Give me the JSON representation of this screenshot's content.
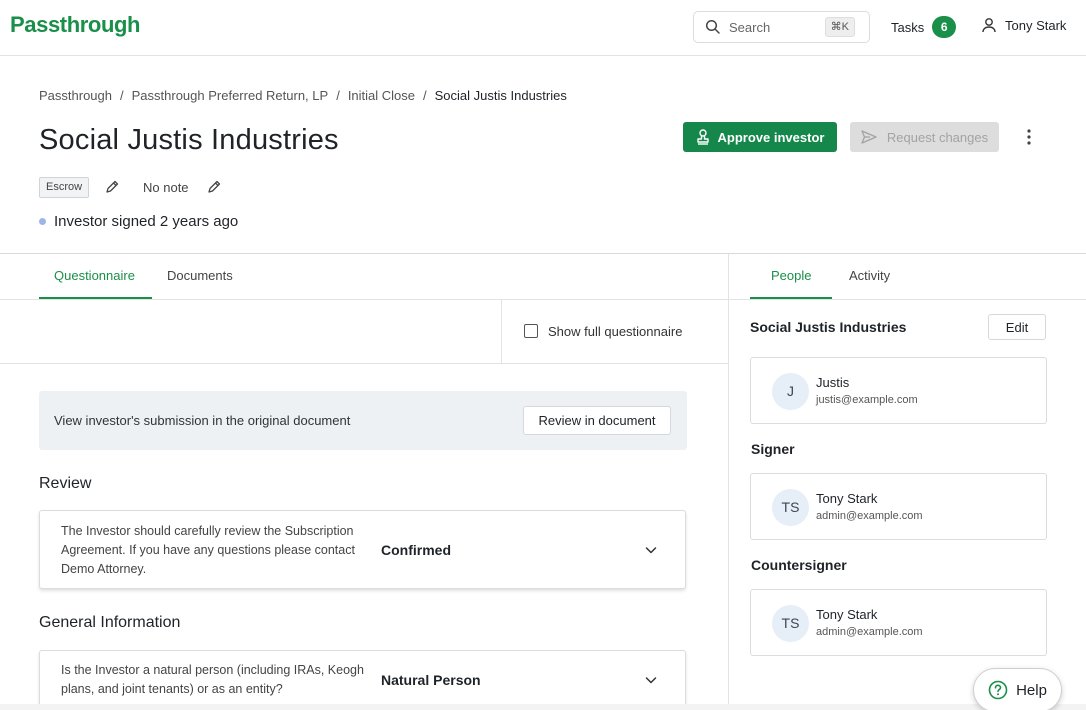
{
  "brand": {
    "logo_text": "Passthrough",
    "accent": "#1a8f4a"
  },
  "topbar": {
    "search_label": "Search",
    "search_shortcut": "⌘K",
    "tasks_label": "Tasks",
    "tasks_count": "6",
    "user_name": "Tony Stark"
  },
  "breadcrumb": [
    {
      "label": "Passthrough"
    },
    {
      "label": "Passthrough Preferred Return, LP"
    },
    {
      "label": "Initial Close"
    },
    {
      "label": "Social Justis Industries"
    }
  ],
  "header": {
    "title": "Social Justis Industries",
    "approve_label": "Approve investor",
    "request_label": "Request changes",
    "chip_label": "Escrow",
    "note_text": "No note",
    "status_text": "Investor signed 2 years ago"
  },
  "left_tabs": [
    {
      "label": "Questionnaire",
      "active": true
    },
    {
      "label": "Documents",
      "active": false
    }
  ],
  "questionnaire": {
    "show_full_label": "Show full questionnaire",
    "banner_text": "View investor's submission in the original document",
    "review_button": "Review in document",
    "sections": [
      {
        "title": "Review",
        "question": "The Investor should carefully review the Subscription Agreement. If you have any questions please contact Demo Attorney.",
        "answer": "Confirmed"
      },
      {
        "title": "General Information",
        "question": "Is the Investor a natural person (including IRAs, Keogh plans, and joint tenants) or as an entity?",
        "answer": "Natural Person"
      }
    ]
  },
  "right_tabs": [
    {
      "label": "People",
      "active": true
    },
    {
      "label": "Activity",
      "active": false
    }
  ],
  "people": {
    "entity_name": "Social Justis Industries",
    "edit_label": "Edit",
    "investor": {
      "initials": "J",
      "name": "Justis",
      "email": "justis@example.com"
    },
    "signer_title": "Signer",
    "signer": {
      "initials": "TS",
      "name": "Tony Stark",
      "email": "admin@example.com"
    },
    "countersigner_title": "Countersigner",
    "countersigner": {
      "initials": "TS",
      "name": "Tony Stark",
      "email": "admin@example.com"
    }
  },
  "help_label": "Help"
}
